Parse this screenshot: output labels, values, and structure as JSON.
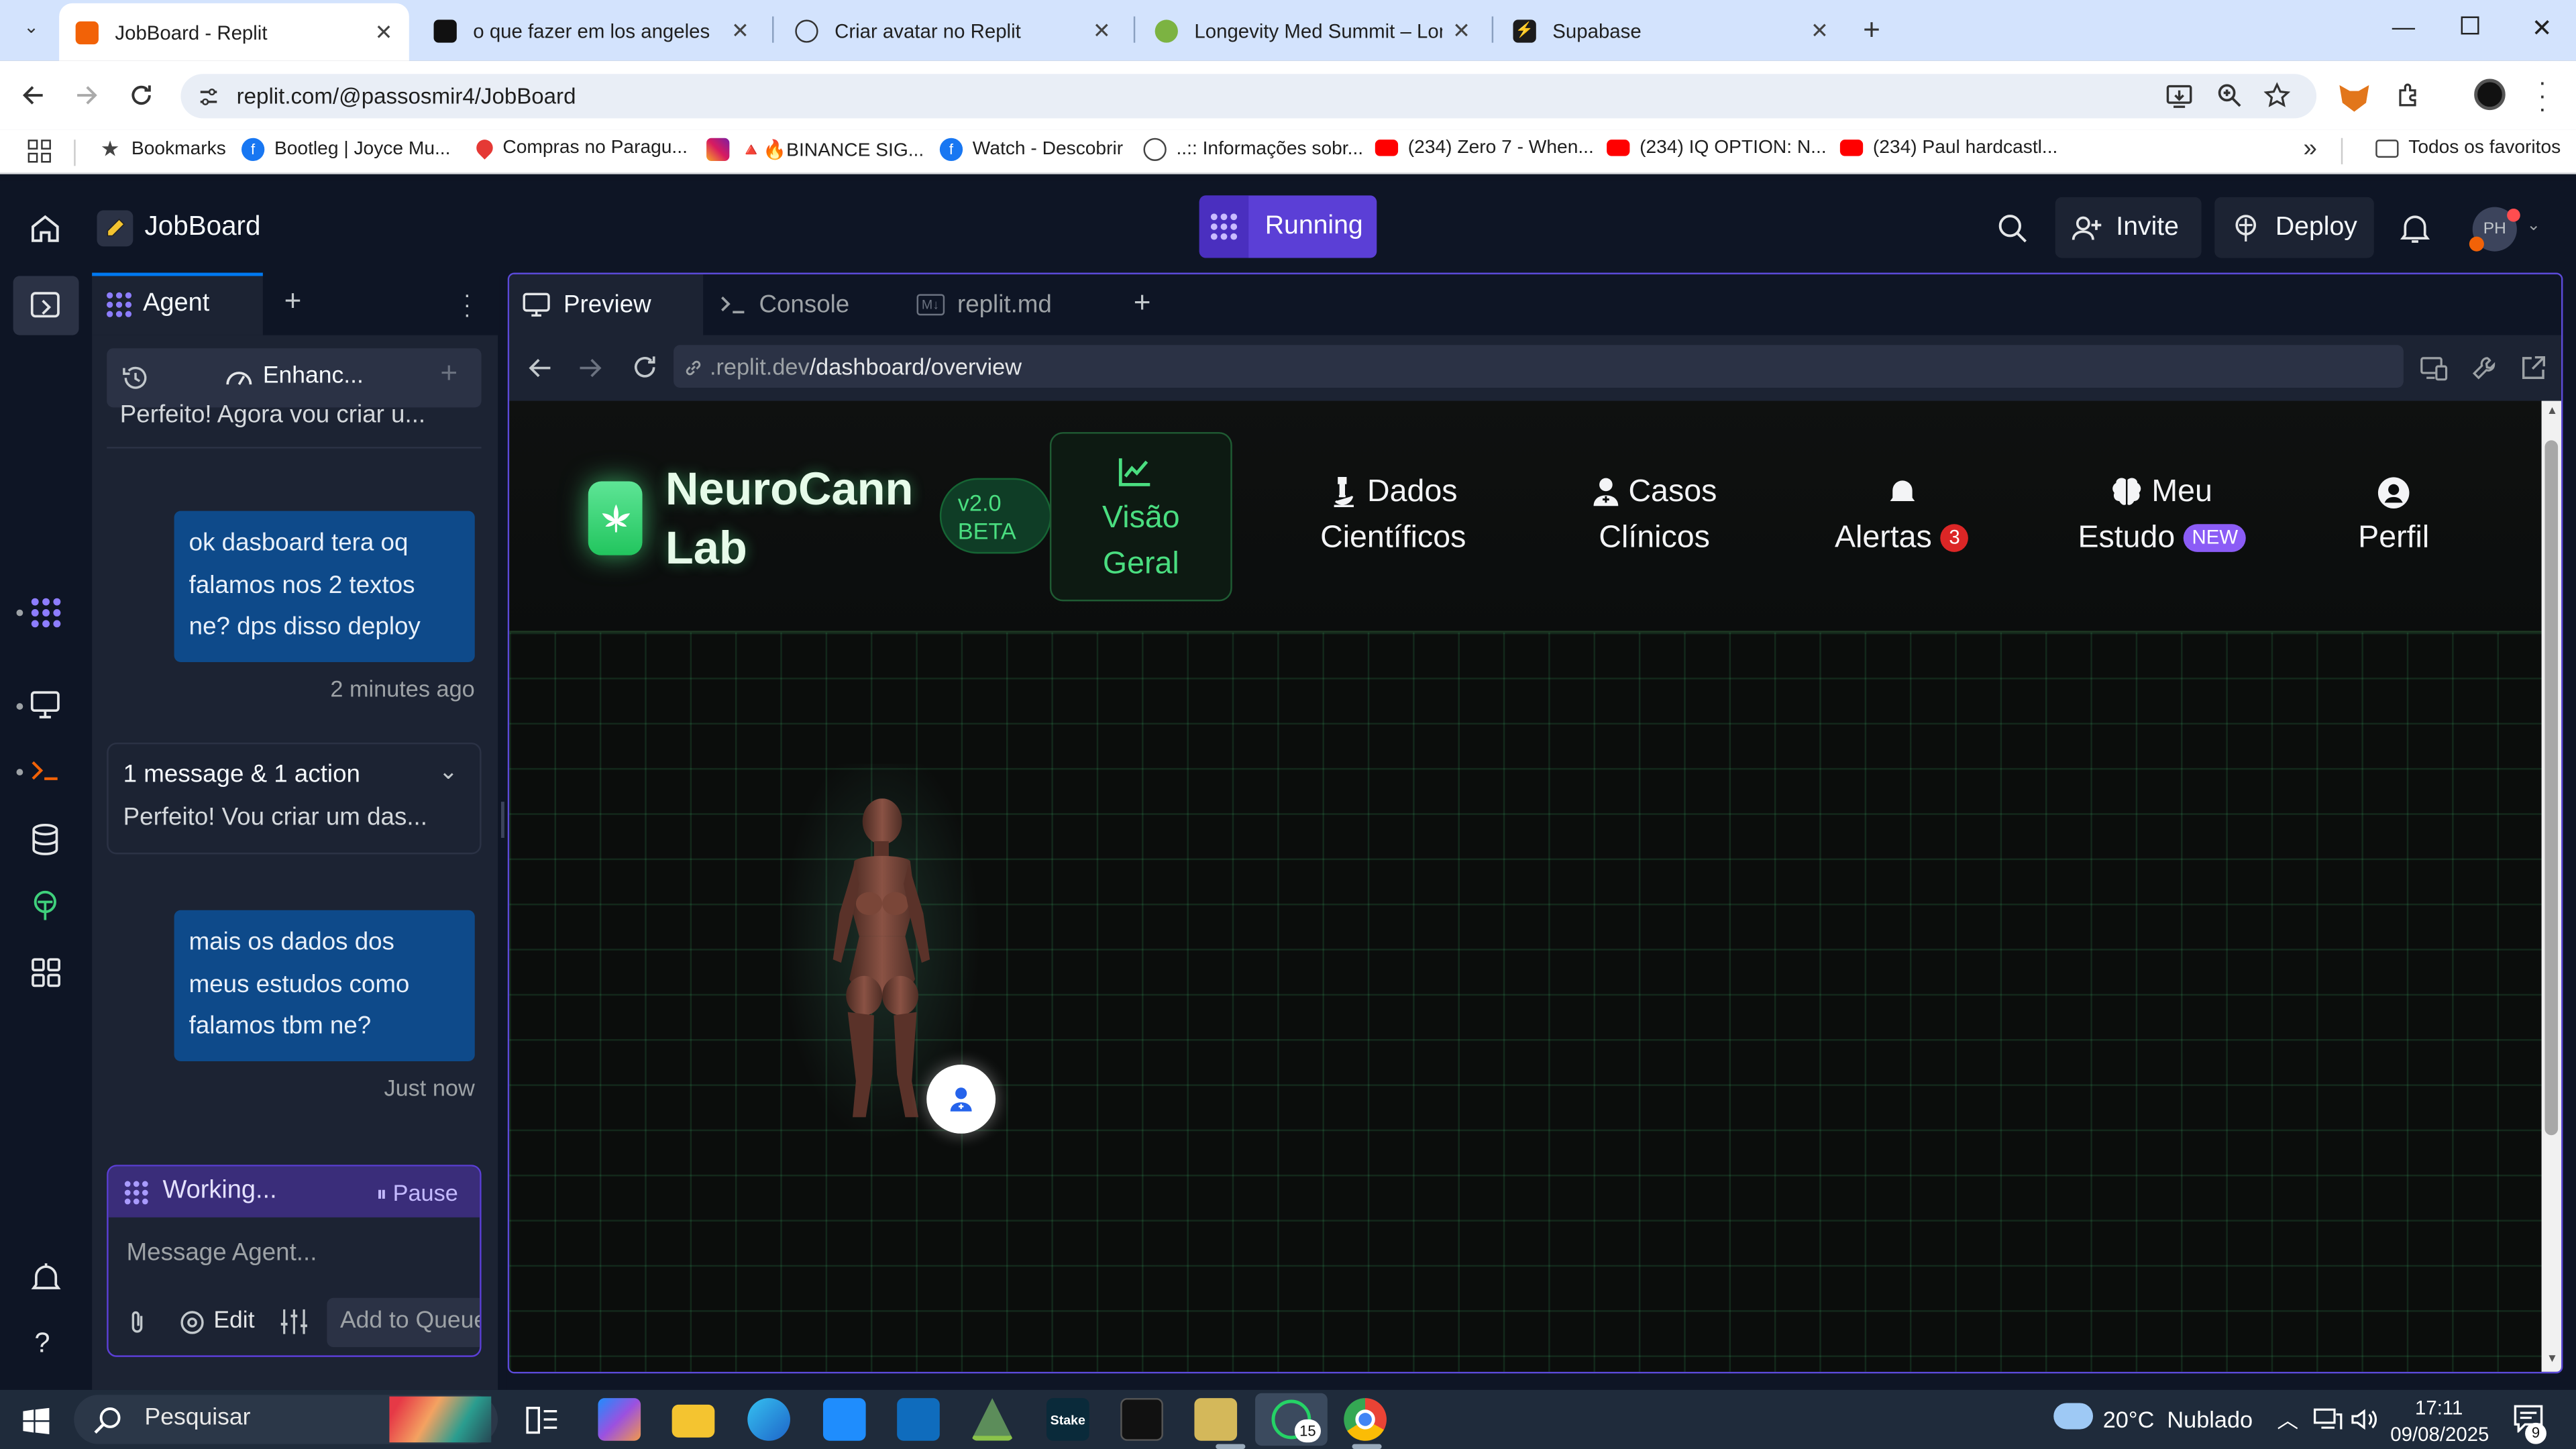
{
  "browser": {
    "tabs": [
      {
        "title": "JobBoard - Replit",
        "active": true,
        "icon": "replit-icon"
      },
      {
        "title": "o que fazer em los angeles",
        "active": false,
        "icon": "openai-icon"
      },
      {
        "title": "Criar avatar no Replit",
        "active": false,
        "icon": "chatgpt-icon"
      },
      {
        "title": "Longevity Med Summit – Longe",
        "active": false,
        "icon": "globe-green-icon"
      },
      {
        "title": "Supabase",
        "active": false,
        "icon": "supabase-icon"
      }
    ],
    "url": "replit.com/@passosmir4/JobBoard",
    "bookmarks": [
      {
        "label": "Bookmarks",
        "icon": "star-icon"
      },
      {
        "label": "Bootleg | Joyce Mu...",
        "icon": "facebook-icon"
      },
      {
        "label": "Compras no Paragu...",
        "icon": "map-pin-icon"
      },
      {
        "label": "🔺🔥BINANCE SIG...",
        "icon": "instagram-icon"
      },
      {
        "label": "Watch - Descobrir",
        "icon": "facebook-icon"
      },
      {
        "label": "..:: Informações sobr...",
        "icon": "globe-icon"
      },
      {
        "label": "(234) Zero 7 - When...",
        "icon": "youtube-icon"
      },
      {
        "label": "(234) IQ OPTION: N...",
        "icon": "youtube-icon"
      },
      {
        "label": "(234) Paul hardcastl...",
        "icon": "youtube-icon"
      }
    ],
    "all_bookmarks": "Todos os favoritos"
  },
  "replit": {
    "project_name": "JobBoard",
    "run_status": "Running",
    "invite_label": "Invite",
    "deploy_label": "Deploy",
    "avatar_initials": "PH",
    "agent": {
      "tab_label": "Agent",
      "enhance_label": "Enhanc...",
      "messages": [
        {
          "role": "agent",
          "text": "Perfeito! Agora vou criar u..."
        },
        {
          "role": "user",
          "text": "ok dasboard tera oq falamos nos 2 textos ne? dps disso deploy",
          "time": "2 minutes ago"
        },
        {
          "role": "agent_group",
          "title": "1 message & 1 action",
          "text": "Perfeito! Vou criar um das..."
        },
        {
          "role": "user",
          "text": "mais os dados dos meus estudos como falamos tbm ne?",
          "time": "Just now"
        }
      ],
      "working_label": "Working...",
      "pause_label": "Pause",
      "input_placeholder": "Message Agent...",
      "edit_label": "Edit",
      "queue_label": "Add to Queue"
    },
    "panel_tabs": [
      {
        "label": "Preview",
        "active": true
      },
      {
        "label": "Console",
        "active": false
      },
      {
        "label": "replit.md",
        "active": false
      }
    ],
    "preview_url_prefix": ".replit.dev",
    "preview_url_path": "/dashboard/overview"
  },
  "app": {
    "brand_line1": "NeuroCann",
    "brand_line2": "Lab",
    "version_line1": "v2.0",
    "version_line2": "BETA",
    "nav": [
      {
        "line1": "Visão",
        "line2": "Geral",
        "icon": "chart-line-icon",
        "active": true
      },
      {
        "line1": "Dados",
        "line2": "Científicos",
        "icon": "microscope-icon",
        "active": false
      },
      {
        "line1": "Casos",
        "line2": "Clínicos",
        "icon": "user-doctor-icon",
        "active": false
      },
      {
        "line1": "Alertas",
        "badge": "3",
        "icon": "bell-icon",
        "active": false
      },
      {
        "line1": "Meu",
        "line2": "Estudo",
        "badge": "NEW",
        "icon": "brain-icon",
        "active": false
      },
      {
        "line1": "Perfil",
        "icon": "user-circle-icon",
        "active": false
      }
    ],
    "colors": {
      "accent": "#4ade80",
      "badge_red": "#dc2626",
      "badge_purple": "#8b5cf6"
    }
  },
  "taskbar": {
    "search_label": "Pesquisar",
    "weather": "20°C  Nublado",
    "time": "17:11",
    "date": "09/08/2025",
    "whatsapp_badge": "15",
    "notification_count": "9"
  }
}
